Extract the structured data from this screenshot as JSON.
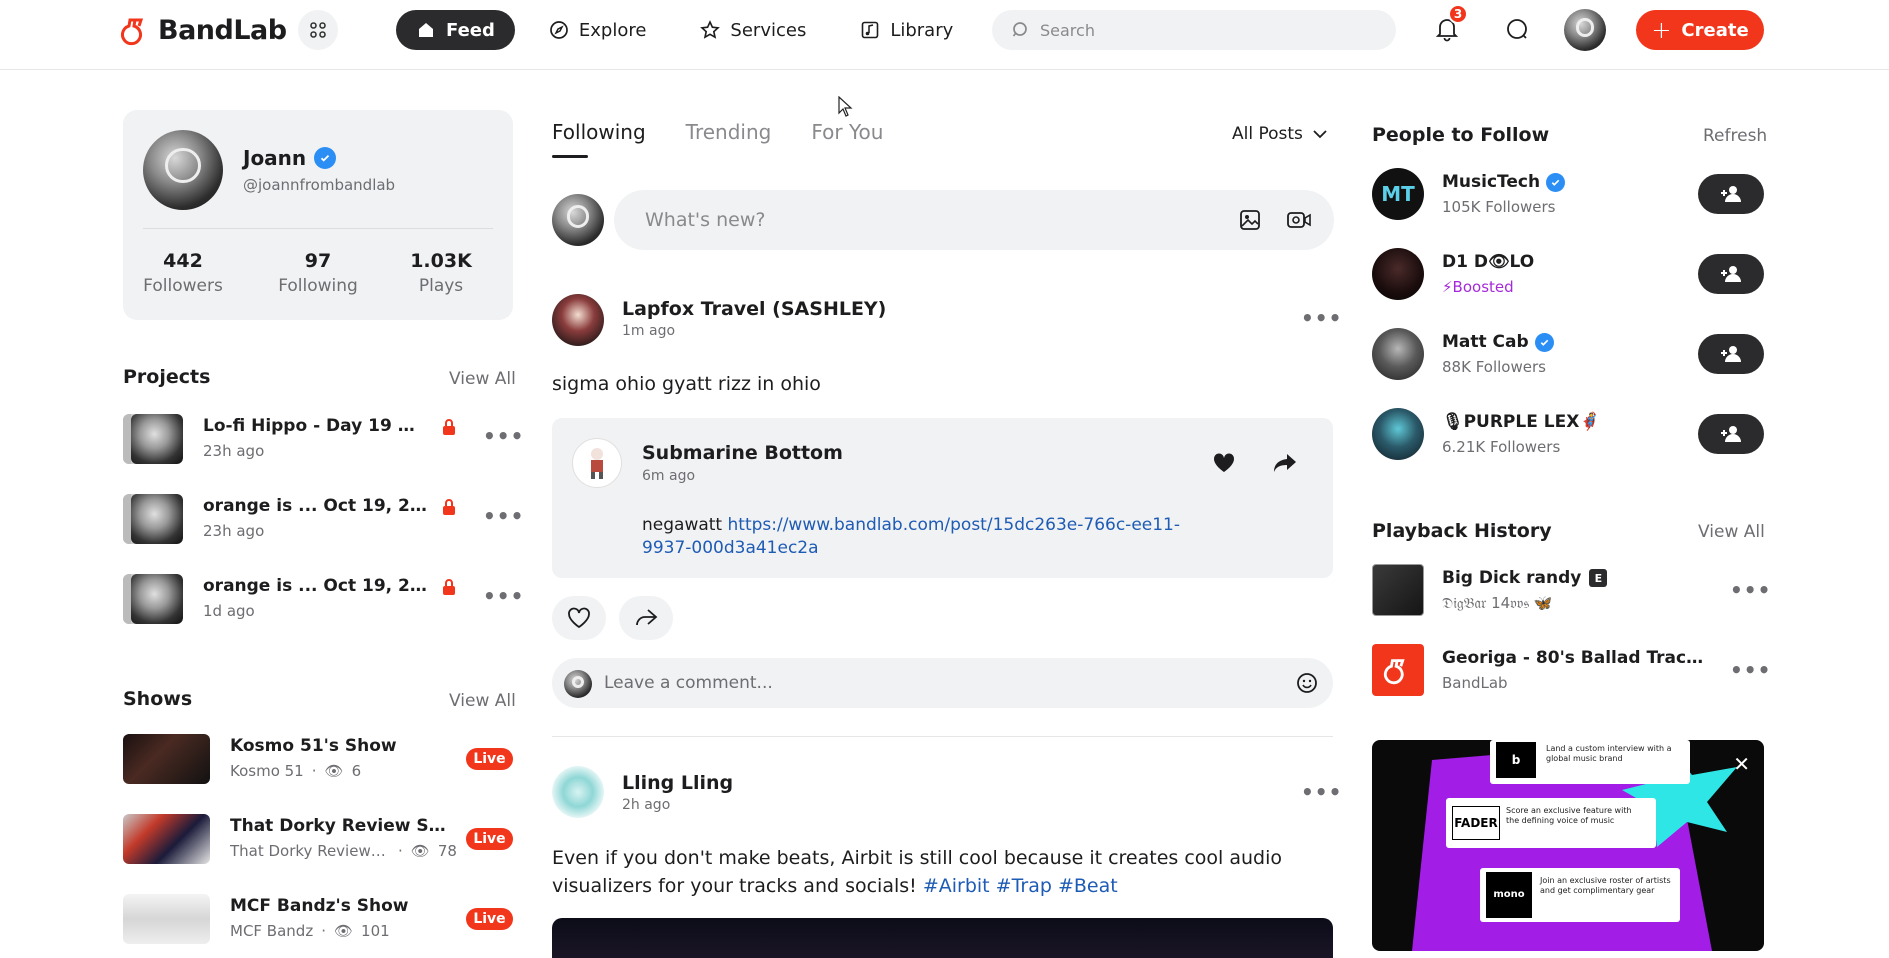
{
  "header": {
    "brand": "BandLab",
    "nav": [
      {
        "label": "Feed",
        "icon": "home-icon",
        "active": true
      },
      {
        "label": "Explore",
        "icon": "compass-icon"
      },
      {
        "label": "Services",
        "icon": "star-icon"
      },
      {
        "label": "Library",
        "icon": "music-note-icon"
      }
    ],
    "search_placeholder": "Search",
    "notification_count": "3",
    "create_label": "Create",
    "accent": "#f2361c"
  },
  "profile": {
    "name": "Joann",
    "handle": "@joannfrombandlab",
    "stats": [
      {
        "value": "442",
        "label": "Followers"
      },
      {
        "value": "97",
        "label": "Following"
      },
      {
        "value": "1.03K",
        "label": "Plays"
      }
    ]
  },
  "projects": {
    "title": "Projects",
    "view_all": "View All",
    "items": [
      {
        "title": "Lo-fi Hippo - Day 19 Oct 2...",
        "time": "23h ago"
      },
      {
        "title": "orange is ... Oct 19, 2023, ...",
        "time": "23h ago"
      },
      {
        "title": "orange is ... Oct 19, 2023, ...",
        "time": "1d ago"
      }
    ]
  },
  "shows": {
    "title": "Shows",
    "view_all": "View All",
    "live_label": "Live",
    "items": [
      {
        "title": "Kosmo 51's Show",
        "host": "Kosmo 51",
        "viewers": "6"
      },
      {
        "title": "That Dorky Review Show'...",
        "host": "That Dorky Review S...",
        "viewers": "78"
      },
      {
        "title": "MCF Bandz's Show",
        "host": "MCF Bandz",
        "viewers": "101"
      }
    ]
  },
  "feed": {
    "tabs": [
      "Following",
      "Trending",
      "For You"
    ],
    "filter": "All Posts",
    "compose_placeholder": "What's new?",
    "posts": [
      {
        "author": "Lapfox Travel (SASHLEY)",
        "time": "1m ago",
        "text": "sigma ohio gyatt rizz in ohio",
        "embed": {
          "author": "Submarine Bottom",
          "time": "6m ago",
          "text": "negawatt ",
          "link": "https://www.bandlab.com/post/15dc263e-766c-ee11-9937-000d3a41ec2a"
        },
        "comment_placeholder": "Leave a comment..."
      },
      {
        "author": "Lling Lling",
        "time": "2h ago",
        "text": "Even if you don't make beats, Airbit is still cool because it creates cool audio visualizers for your tracks and socials! ",
        "hashtags": [
          "#Airbit",
          "#Trap",
          "#Beat"
        ]
      }
    ]
  },
  "people_to_follow": {
    "title": "People to Follow",
    "refresh": "Refresh",
    "items": [
      {
        "name": "MusicTech",
        "sub": "105K Followers",
        "verified": true
      },
      {
        "name": "D1 D👁LO",
        "sub": "Boosted",
        "boosted": true
      },
      {
        "name": "Matt Cab",
        "sub": "88K Followers",
        "verified": true
      },
      {
        "name": "🎙PURPLE LEX🦸",
        "sub": "6.21K Followers"
      }
    ]
  },
  "playback_history": {
    "title": "Playback History",
    "view_all": "View All",
    "items": [
      {
        "title": "Big Dick randy",
        "explicit": "E",
        "artist": "𝔇𝔦𝔤𝔅𝔞𝔯 14𝔳𝔳𝔰 🦋"
      },
      {
        "title": "Georiga - 80's Ballad Track in ...",
        "artist": "BandLab"
      }
    ]
  },
  "ad": {
    "cards": [
      {
        "logo": "b",
        "text": "Land a custom interview with a global music brand"
      },
      {
        "logo": "FADER",
        "text": "Score an exclusive feature with the defining voice of music"
      },
      {
        "logo": "mono",
        "text": "Join an exclusive roster of artists and get complimentary gear"
      }
    ]
  }
}
